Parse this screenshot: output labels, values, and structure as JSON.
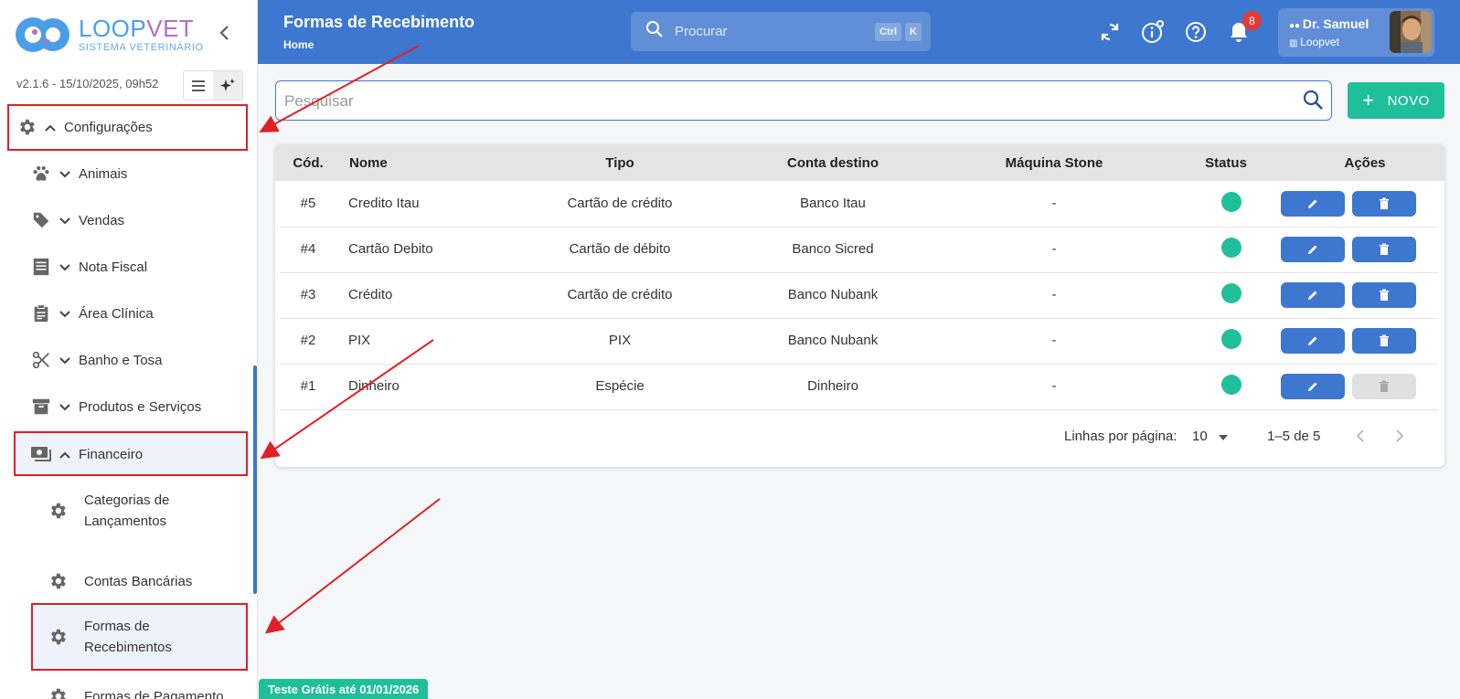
{
  "brand": {
    "name_left": "LOOP",
    "name_right": "VET",
    "subtitle": "SISTEMA VETERINÁRIO"
  },
  "version": "v2.1.6 - 15/10/2025, 09h52",
  "sidebar": {
    "items": [
      {
        "label": "Configurações",
        "icon": "gear-icon"
      },
      {
        "label": "Animais",
        "icon": "paw-icon"
      },
      {
        "label": "Vendas",
        "icon": "tag-icon"
      },
      {
        "label": "Nota Fiscal",
        "icon": "receipt-icon"
      },
      {
        "label": "Área Clínica",
        "icon": "clipboard-icon"
      },
      {
        "label": "Banho e Tosa",
        "icon": "scissors-icon"
      },
      {
        "label": "Produtos e Serviços",
        "icon": "archive-icon"
      },
      {
        "label": "Financeiro",
        "icon": "money-icon"
      }
    ],
    "sub_items": [
      {
        "label": "Categorias de Lançamentos"
      },
      {
        "label": "Contas Bancárias"
      },
      {
        "label": "Formas de Recebimentos"
      },
      {
        "label": "Formas de Pagamento"
      }
    ]
  },
  "header": {
    "title": "Formas de Recebimento",
    "breadcrumb": "Home",
    "search_placeholder": "Procurar",
    "shortcut_ctrl": "Ctrl",
    "shortcut_key": "K",
    "notifications_count": "8",
    "user_name": "Dr. Samuel",
    "user_org": "Loopvet"
  },
  "main": {
    "filter_placeholder": "Pesquisar",
    "new_button": "NOVO",
    "table": {
      "headers": [
        "Cód.",
        "Nome",
        "Tipo",
        "Conta destino",
        "Máquina Stone",
        "Status",
        "Ações"
      ],
      "rows": [
        {
          "code": "#5",
          "name": "Credito Itau",
          "type": "Cartão de crédito",
          "account": "Banco Itau",
          "stone": "-",
          "status": "active",
          "delete_enabled": true
        },
        {
          "code": "#4",
          "name": "Cartão Debito",
          "type": "Cartão de débito",
          "account": "Banco Sicred",
          "stone": "-",
          "status": "active",
          "delete_enabled": true
        },
        {
          "code": "#3",
          "name": "Crédito",
          "type": "Cartão de crédito",
          "account": "Banco Nubank",
          "stone": "-",
          "status": "active",
          "delete_enabled": true
        },
        {
          "code": "#2",
          "name": "PIX",
          "type": "PIX",
          "account": "Banco Nubank",
          "stone": "-",
          "status": "active",
          "delete_enabled": true
        },
        {
          "code": "#1",
          "name": "Dinheiro",
          "type": "Espécie",
          "account": "Dinheiro",
          "stone": "-",
          "status": "active",
          "delete_enabled": false
        }
      ]
    },
    "pagination": {
      "rows_label": "Linhas por página:",
      "rows_value": "10",
      "range": "1–5 de 5"
    }
  },
  "trial_banner": "Teste Grátis até 01/01/2026",
  "colors": {
    "primary": "#3e77cf",
    "success": "#1fbf9a",
    "danger": "#e53935",
    "annotation": "#e01f26"
  }
}
